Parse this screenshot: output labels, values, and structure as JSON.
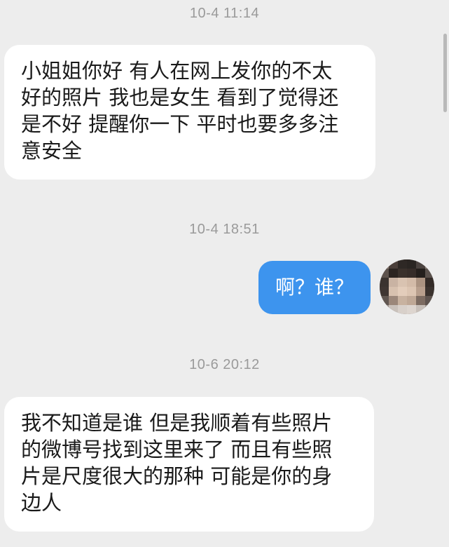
{
  "messages": [
    {
      "type": "timestamp",
      "text": "10-4 11:14"
    },
    {
      "type": "incoming",
      "text": "小姐姐你好 有人在网上发你的不太\n好的照片 我也是女生 看到了觉得还\n是不好 提醒你一下 平时也要多多注\n意安全"
    },
    {
      "type": "timestamp",
      "text": "10-4 18:51"
    },
    {
      "type": "outgoing",
      "text": "啊？谁？"
    },
    {
      "type": "timestamp",
      "text": "10-6 20:12"
    },
    {
      "type": "incoming",
      "text": "我不知道是谁 但是我顺着有些照片\n的微博号找到这里来了 而且有些照\n片是尺度很大的那种 可能是你的身\n边人"
    }
  ],
  "colors": {
    "background": "#ededed",
    "incoming_bubble": "#ffffff",
    "outgoing_bubble": "#3d94ee",
    "timestamp_text": "#9a9a9a"
  }
}
